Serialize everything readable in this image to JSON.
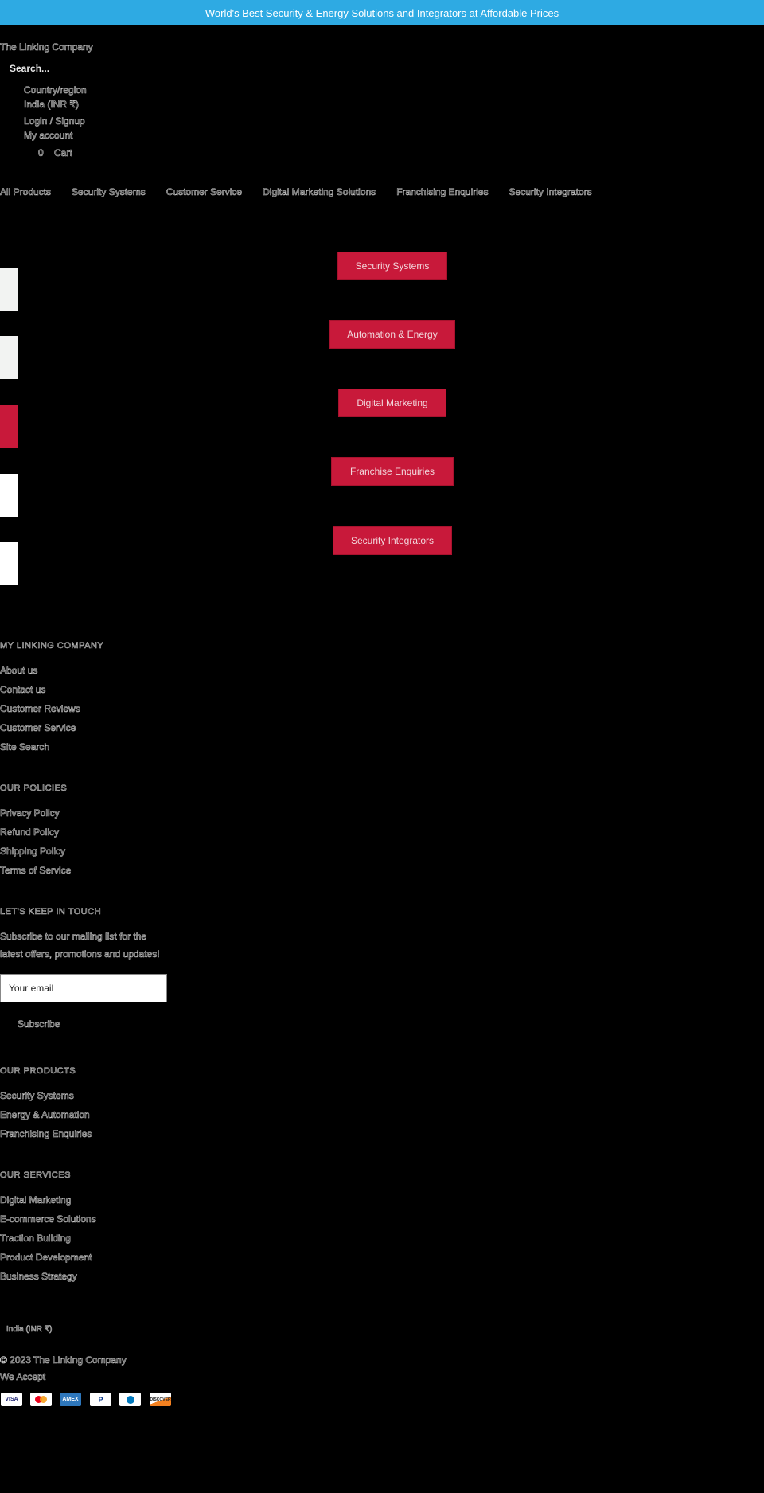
{
  "announcement": "World's Best Security & Energy Solutions and Integrators at Affordable Prices",
  "header": {
    "logo": "The Linking Company",
    "search_placeholder": "Search...",
    "country_label": "Country/region",
    "country_value": "India (INR ₹)",
    "login": "Login / Signup",
    "account": "My account",
    "cart_count": "0",
    "cart_label": "Cart"
  },
  "nav": [
    "All Products",
    "Security Systems",
    "Customer Service",
    "Digital Marketing Solutions",
    "Franchising Enquiries",
    "Security Integrators"
  ],
  "hero": {
    "buttons": [
      "Security Systems",
      "Automation & Energy",
      "Digital Marketing",
      "Franchise Enquiries",
      "Security Integrators"
    ],
    "side_block_colors": [
      "#f2f3f2",
      "#f2f3f2",
      "#c8193a",
      "#ffffff",
      "#ffffff"
    ]
  },
  "footer": {
    "sections": [
      {
        "title": "MY LINKING COMPANY",
        "links": [
          "About us",
          "Contact us",
          "Customer Reviews",
          "Customer Service",
          "Site Search"
        ]
      },
      {
        "title": "OUR POLICIES",
        "links": [
          "Privacy Policy",
          "Refund Policy",
          "Shipping Policy",
          "Terms of Service"
        ]
      }
    ],
    "newsletter": {
      "title": "LET'S KEEP IN TOUCH",
      "text_line1": "Subscribe to our mailing list for the",
      "text_line2": "latest offers, promotions and updates!",
      "email_placeholder": "Your email",
      "subscribe": "Subscribe"
    },
    "sections2": [
      {
        "title": "OUR PRODUCTS",
        "links": [
          "Security Systems",
          "Energy & Automation",
          "Franchising Enquiries"
        ]
      },
      {
        "title": "OUR SERVICES",
        "links": [
          "Digital Marketing",
          "E-commerce Solutions",
          "Traction Building",
          "Product Development",
          "Business Strategy"
        ]
      }
    ],
    "country": "India (INR ₹)",
    "copyright": "© 2023 The Linking Company",
    "we_accept": "We Accept",
    "payments": [
      "VISA",
      "Mastercard",
      "AMEX",
      "PayPal",
      "Diners Club",
      "DISCOVER"
    ]
  },
  "colors": {
    "announcement_bg": "#2eaae3",
    "accent_red": "#c8193a",
    "background": "#000000"
  }
}
